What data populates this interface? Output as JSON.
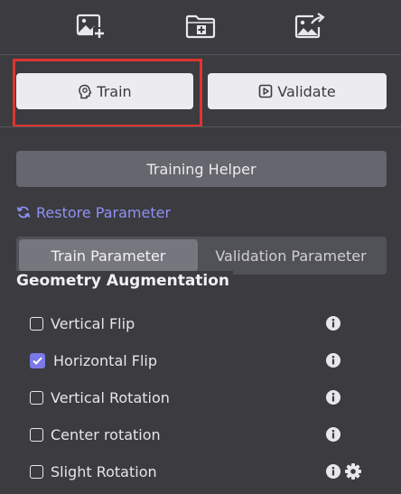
{
  "toolbar": {
    "icons": [
      "add-image-icon",
      "add-folder-icon",
      "export-image-icon"
    ]
  },
  "actions": {
    "train_label": "Train",
    "validate_label": "Validate"
  },
  "helper": {
    "label": "Training Helper"
  },
  "restore": {
    "label": "Restore Parameter"
  },
  "tabs": [
    {
      "label": "Train Parameter",
      "active": true
    },
    {
      "label": "Validation Parameter",
      "active": false
    }
  ],
  "section": {
    "title": "Geometry Augmentation"
  },
  "options": [
    {
      "label": "Vertical Flip",
      "checked": false
    },
    {
      "label": "Horizontal Flip",
      "checked": true
    },
    {
      "label": "Vertical Rotation",
      "checked": false
    },
    {
      "label": "Center rotation",
      "checked": false
    },
    {
      "label": "Slight Rotation",
      "checked": false
    }
  ],
  "colors": {
    "background": "#3b3b40",
    "accent": "#7b78e8",
    "link": "#8f90f2",
    "highlight": "#e0342f"
  }
}
